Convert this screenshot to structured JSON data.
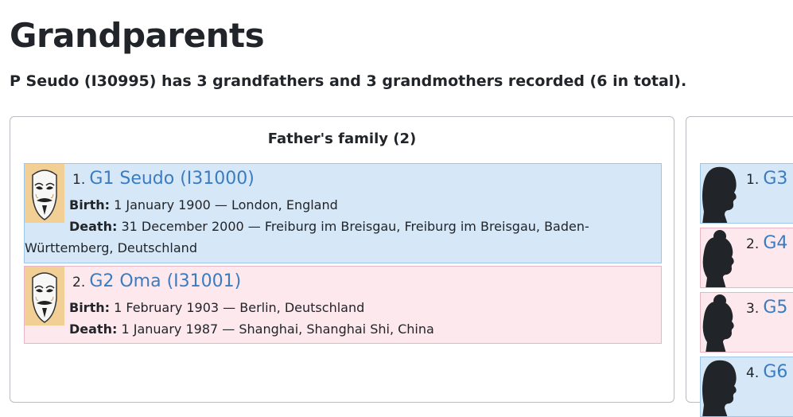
{
  "page": {
    "title": "Grandparents",
    "summary": "P Seudo (I30995) has 3 grandfathers and 3 grandmothers recorded (6 in total)."
  },
  "father_family": {
    "title": "Father's family (2)",
    "people": [
      {
        "number": "1.",
        "name": "G1 Seudo (I31000)",
        "birth_label": "Birth:",
        "birth": "1 January 1900 — London, England",
        "death_label": "Death:",
        "death": "31 December 2000 — Freiburg im Breisgau, Freiburg im Breisgau, Baden-Württemberg, Deutschland"
      },
      {
        "number": "2.",
        "name": "G2 Oma (I31001)",
        "birth_label": "Birth:",
        "birth": "1 February 1903 — Berlin, Deutschland",
        "death_label": "Death:",
        "death": "1 January 1987 — Shanghai, Shanghai Shi, China"
      }
    ]
  },
  "mother_family": {
    "people": [
      {
        "number": "1.",
        "name": "G3"
      },
      {
        "number": "2.",
        "name": "G4"
      },
      {
        "number": "3.",
        "name": "G5"
      },
      {
        "number": "4.",
        "name": "G6"
      }
    ]
  },
  "colors": {
    "male_bg": "#d6e8f8",
    "female_bg": "#fde8ee",
    "link": "#3b7cc0"
  },
  "icons": {
    "thumbnail": "mask-portrait-icon",
    "male_placeholder": "male-silhouette-icon",
    "female_placeholder": "female-silhouette-icon"
  }
}
